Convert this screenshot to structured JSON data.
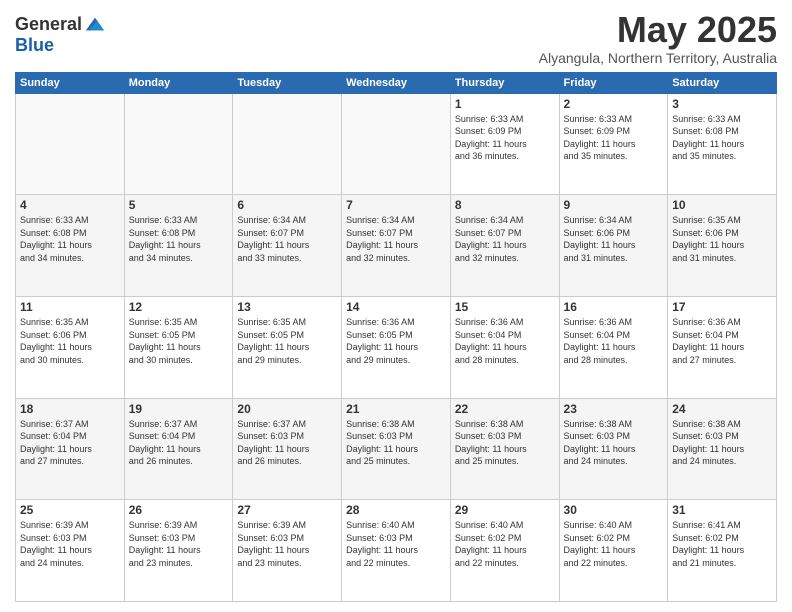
{
  "logo": {
    "general": "General",
    "blue": "Blue"
  },
  "title": "May 2025",
  "location": "Alyangula, Northern Territory, Australia",
  "days_of_week": [
    "Sunday",
    "Monday",
    "Tuesday",
    "Wednesday",
    "Thursday",
    "Friday",
    "Saturday"
  ],
  "weeks": [
    [
      {
        "day": "",
        "info": ""
      },
      {
        "day": "",
        "info": ""
      },
      {
        "day": "",
        "info": ""
      },
      {
        "day": "",
        "info": ""
      },
      {
        "day": "1",
        "info": "Sunrise: 6:33 AM\nSunset: 6:09 PM\nDaylight: 11 hours\nand 36 minutes."
      },
      {
        "day": "2",
        "info": "Sunrise: 6:33 AM\nSunset: 6:09 PM\nDaylight: 11 hours\nand 35 minutes."
      },
      {
        "day": "3",
        "info": "Sunrise: 6:33 AM\nSunset: 6:08 PM\nDaylight: 11 hours\nand 35 minutes."
      }
    ],
    [
      {
        "day": "4",
        "info": "Sunrise: 6:33 AM\nSunset: 6:08 PM\nDaylight: 11 hours\nand 34 minutes."
      },
      {
        "day": "5",
        "info": "Sunrise: 6:33 AM\nSunset: 6:08 PM\nDaylight: 11 hours\nand 34 minutes."
      },
      {
        "day": "6",
        "info": "Sunrise: 6:34 AM\nSunset: 6:07 PM\nDaylight: 11 hours\nand 33 minutes."
      },
      {
        "day": "7",
        "info": "Sunrise: 6:34 AM\nSunset: 6:07 PM\nDaylight: 11 hours\nand 32 minutes."
      },
      {
        "day": "8",
        "info": "Sunrise: 6:34 AM\nSunset: 6:07 PM\nDaylight: 11 hours\nand 32 minutes."
      },
      {
        "day": "9",
        "info": "Sunrise: 6:34 AM\nSunset: 6:06 PM\nDaylight: 11 hours\nand 31 minutes."
      },
      {
        "day": "10",
        "info": "Sunrise: 6:35 AM\nSunset: 6:06 PM\nDaylight: 11 hours\nand 31 minutes."
      }
    ],
    [
      {
        "day": "11",
        "info": "Sunrise: 6:35 AM\nSunset: 6:06 PM\nDaylight: 11 hours\nand 30 minutes."
      },
      {
        "day": "12",
        "info": "Sunrise: 6:35 AM\nSunset: 6:05 PM\nDaylight: 11 hours\nand 30 minutes."
      },
      {
        "day": "13",
        "info": "Sunrise: 6:35 AM\nSunset: 6:05 PM\nDaylight: 11 hours\nand 29 minutes."
      },
      {
        "day": "14",
        "info": "Sunrise: 6:36 AM\nSunset: 6:05 PM\nDaylight: 11 hours\nand 29 minutes."
      },
      {
        "day": "15",
        "info": "Sunrise: 6:36 AM\nSunset: 6:04 PM\nDaylight: 11 hours\nand 28 minutes."
      },
      {
        "day": "16",
        "info": "Sunrise: 6:36 AM\nSunset: 6:04 PM\nDaylight: 11 hours\nand 28 minutes."
      },
      {
        "day": "17",
        "info": "Sunrise: 6:36 AM\nSunset: 6:04 PM\nDaylight: 11 hours\nand 27 minutes."
      }
    ],
    [
      {
        "day": "18",
        "info": "Sunrise: 6:37 AM\nSunset: 6:04 PM\nDaylight: 11 hours\nand 27 minutes."
      },
      {
        "day": "19",
        "info": "Sunrise: 6:37 AM\nSunset: 6:04 PM\nDaylight: 11 hours\nand 26 minutes."
      },
      {
        "day": "20",
        "info": "Sunrise: 6:37 AM\nSunset: 6:03 PM\nDaylight: 11 hours\nand 26 minutes."
      },
      {
        "day": "21",
        "info": "Sunrise: 6:38 AM\nSunset: 6:03 PM\nDaylight: 11 hours\nand 25 minutes."
      },
      {
        "day": "22",
        "info": "Sunrise: 6:38 AM\nSunset: 6:03 PM\nDaylight: 11 hours\nand 25 minutes."
      },
      {
        "day": "23",
        "info": "Sunrise: 6:38 AM\nSunset: 6:03 PM\nDaylight: 11 hours\nand 24 minutes."
      },
      {
        "day": "24",
        "info": "Sunrise: 6:38 AM\nSunset: 6:03 PM\nDaylight: 11 hours\nand 24 minutes."
      }
    ],
    [
      {
        "day": "25",
        "info": "Sunrise: 6:39 AM\nSunset: 6:03 PM\nDaylight: 11 hours\nand 24 minutes."
      },
      {
        "day": "26",
        "info": "Sunrise: 6:39 AM\nSunset: 6:03 PM\nDaylight: 11 hours\nand 23 minutes."
      },
      {
        "day": "27",
        "info": "Sunrise: 6:39 AM\nSunset: 6:03 PM\nDaylight: 11 hours\nand 23 minutes."
      },
      {
        "day": "28",
        "info": "Sunrise: 6:40 AM\nSunset: 6:03 PM\nDaylight: 11 hours\nand 22 minutes."
      },
      {
        "day": "29",
        "info": "Sunrise: 6:40 AM\nSunset: 6:02 PM\nDaylight: 11 hours\nand 22 minutes."
      },
      {
        "day": "30",
        "info": "Sunrise: 6:40 AM\nSunset: 6:02 PM\nDaylight: 11 hours\nand 22 minutes."
      },
      {
        "day": "31",
        "info": "Sunrise: 6:41 AM\nSunset: 6:02 PM\nDaylight: 11 hours\nand 21 minutes."
      }
    ]
  ]
}
